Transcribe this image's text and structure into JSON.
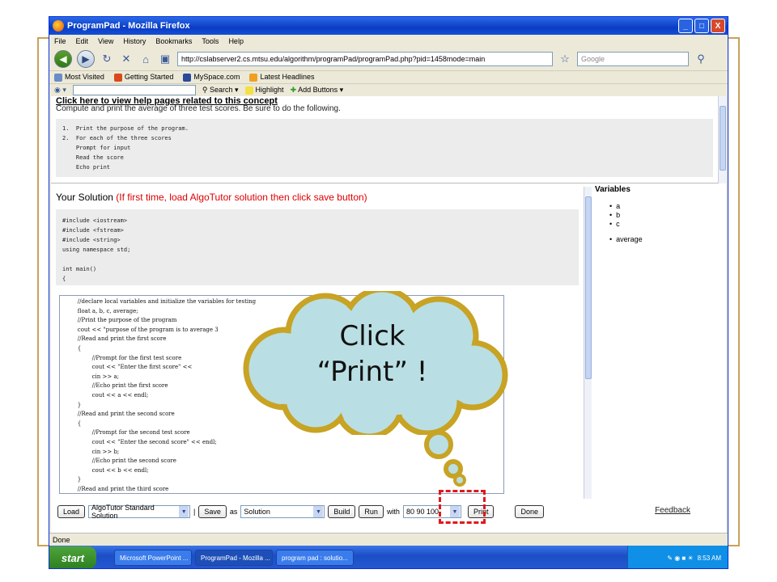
{
  "window": {
    "title": "ProgramPad - Mozilla Firefox",
    "buttons": [
      "_",
      "□",
      "X"
    ]
  },
  "menu": [
    "File",
    "Edit",
    "View",
    "History",
    "Bookmarks",
    "Tools",
    "Help"
  ],
  "nav": {
    "url": "http://cslabserver2.cs.mtsu.edu/algorithm/programPad/programPad.php?pid=1458mode=main",
    "search_placeholder": "Google"
  },
  "bookmarks": [
    "Most Visited",
    "Getting Started",
    "MySpace.com",
    "Latest Headlines"
  ],
  "toolbar2": {
    "search_label": "Search",
    "highlight_label": "Highlight",
    "add_buttons_label": "Add Buttons"
  },
  "problem": {
    "help_link": "Click here to view help pages related to this concept",
    "description": "Compute and print the average of three test scores. Be sure to do the following.",
    "steps": [
      "1.  Print the purpose of the program.",
      "2.  For each of the three scores",
      "    Prompt for input",
      "    Read the score",
      "    Echo print"
    ]
  },
  "solution": {
    "title": "Your Solution",
    "hint": "(If first time, load AlgoTutor solution then click save button)",
    "header_code": "#include <iostream>\n#include <fstream>\n#include <string>\nusing namespace std;\n\nint main()\n{"
  },
  "code_lines": [
    "        //declare local variables and initialize the variables for testing",
    "        float a, b, c, average;",
    "        //Print the purpose of the program",
    "        cout << \"purpose of the program is to average 3",
    "        //Read and print the first score",
    "        {",
    "                //Prompt for the first test score",
    "                cout << \"Enter the first score\" <<",
    "                cin >> a;",
    "                //Echo print the first score",
    "                cout << a << endl;",
    "        }",
    "        //Read and print the second score",
    "        {",
    "                //Prompt for the second test score",
    "                cout << \"Enter the second score\" << endl;",
    "                cin >> b;",
    "                //Echo print the second score",
    "                cout << b << endl;",
    "        }",
    "        //Read and print the third score"
  ],
  "variables": {
    "title": "Variables",
    "items": [
      "a",
      "b",
      "c"
    ],
    "extra": [
      "average"
    ]
  },
  "bottom": {
    "load_label": "Load",
    "solution_select": "AlgoTutor Standard Solution",
    "separator": "|",
    "save_label": "Save",
    "as_label": "as",
    "save_as_select": "Solution",
    "build_label": "Build",
    "run_label": "Run",
    "with_label": "with",
    "input_value": "80 90 100",
    "print_label": "Print",
    "done_label": "Done",
    "feedback_label": "Feedback"
  },
  "status": "Done",
  "taskbar": {
    "start_label": "start",
    "tasks": [
      "Microsoft PowerPoint ...",
      "ProgramPad - Mozilla ...",
      "program pad : solutio..."
    ],
    "clock": "8:53 AM"
  },
  "callout": {
    "line1": "Click",
    "line2": "“Print” !"
  },
  "colors": {
    "cloud_fill": "#b9dfe4",
    "cloud_outline": "#c8a324",
    "highlight_box": "#e0181c",
    "hint_text": "#dd0000"
  }
}
